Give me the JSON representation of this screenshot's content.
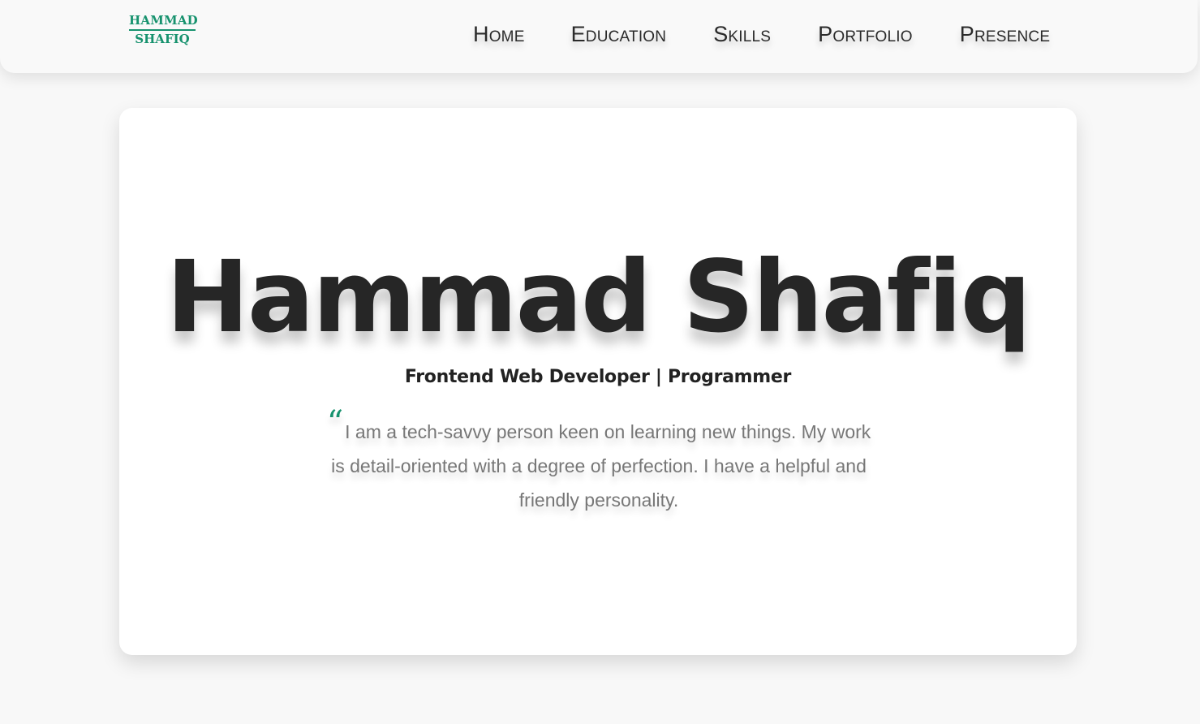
{
  "header": {
    "logo_line1": "HAMMAD",
    "logo_line2": "SHAFIQ",
    "nav": [
      "Home",
      "Education",
      "Skills",
      "Portfolio",
      "Presence"
    ]
  },
  "hero": {
    "name": "Hammad Shafiq",
    "subtitle": "Frontend Web Developer | Programmer",
    "quote_mark": "“",
    "quote": "I am a tech-savvy person keen on learning new things. My work is detail-oriented with a degree of perfection. I have a helpful and friendly personality."
  },
  "colors": {
    "accent": "#17926e",
    "background": "#f8f8f8",
    "card": "#ffffff",
    "text_dark": "#262626",
    "text_muted": "#777777"
  }
}
